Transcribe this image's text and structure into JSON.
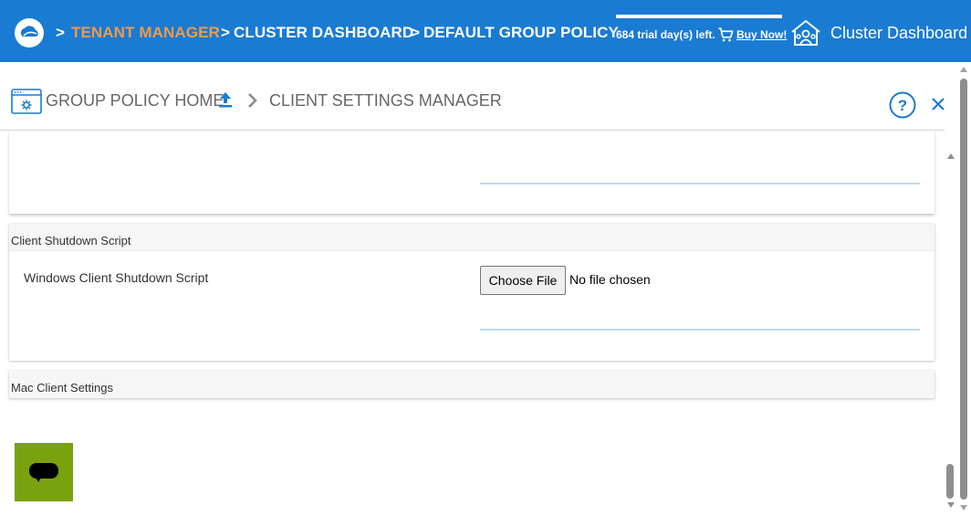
{
  "header": {
    "breadcrumb": [
      {
        "sep": ">",
        "label": "TENANT MANAGER"
      },
      {
        "sep": ">",
        "label": "CLUSTER DASHBOARD"
      },
      {
        "sep": ">",
        "label": "DEFAULT GROUP POLICY"
      }
    ],
    "trial_text": "684 trial day(s) left.",
    "buy_now": "Buy Now!",
    "page_title": "Cluster Dashboard"
  },
  "subheader": {
    "home_label": "GROUP POLICY HOME",
    "current_label": "CLIENT SETTINGS MANAGER",
    "help": "?"
  },
  "sections": {
    "shutdown": {
      "title": "Client Shutdown Script",
      "field_label": "Windows Client Shutdown Script",
      "button_label": "Choose File",
      "file_status": "No file chosen"
    },
    "mac": {
      "title": "Mac Client Settings"
    }
  },
  "colors": {
    "topbar": "#1a7bd2",
    "accent_orange": "#f29a4a",
    "chat_button": "#7aa20e"
  },
  "icons": [
    "cloud-logo-icon",
    "cart-icon",
    "cluster-home-icon",
    "group-policy-icon",
    "upload-icon",
    "chevron-right-icon",
    "help-icon",
    "close-icon",
    "chat-icon"
  ]
}
